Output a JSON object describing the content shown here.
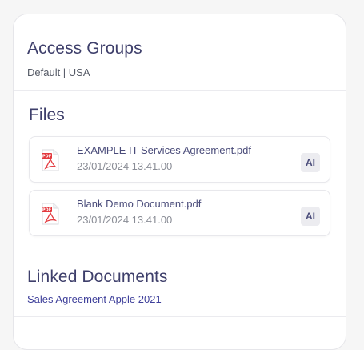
{
  "access": {
    "title": "Access Groups",
    "groups": "Default | USA"
  },
  "files": {
    "title": "Files",
    "items": [
      {
        "name": "EXAMPLE IT Services Agreement.pdf",
        "date": "23/01/2024 13.41.00",
        "ai_label": "AI"
      },
      {
        "name": "Blank Demo Document.pdf",
        "date": "23/01/2024 13.41.00",
        "ai_label": "AI"
      }
    ]
  },
  "linked": {
    "title": "Linked Documents",
    "items": [
      "Sales Agreement Apple 2021"
    ]
  },
  "colors": {
    "heading": "#3e3f6b",
    "pdf_red": "#e3393e",
    "link": "#3e3f9a"
  }
}
